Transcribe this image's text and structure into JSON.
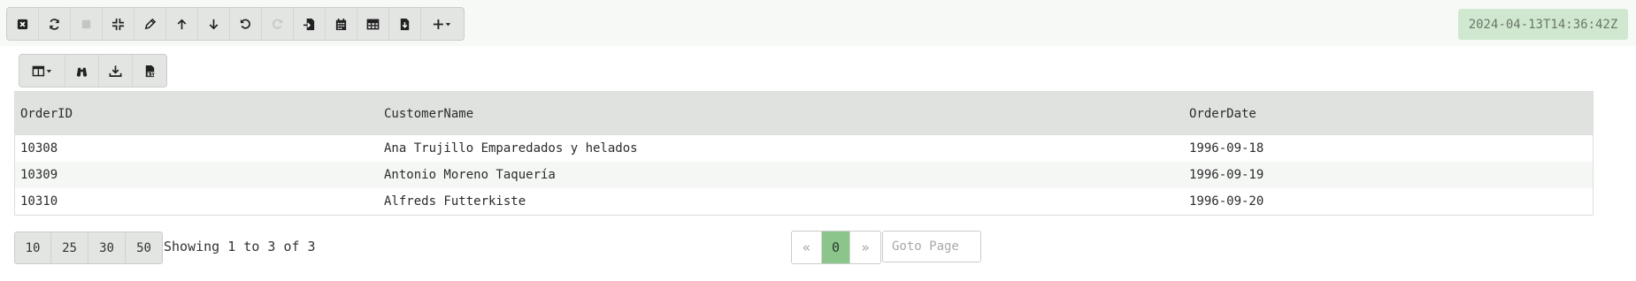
{
  "toolbar": {
    "buttons": [
      {
        "icon": "close-icon",
        "disabled": false
      },
      {
        "icon": "refresh-icon",
        "disabled": false
      },
      {
        "icon": "stop-icon",
        "disabled": true
      },
      {
        "icon": "compress-icon",
        "disabled": false
      },
      {
        "icon": "pencil-icon",
        "disabled": false
      },
      {
        "icon": "arrow-up-icon",
        "disabled": false
      },
      {
        "icon": "arrow-down-icon",
        "disabled": false
      },
      {
        "icon": "undo-icon",
        "disabled": false
      },
      {
        "icon": "redo-icon",
        "disabled": true
      },
      {
        "icon": "import-file-icon",
        "disabled": false
      },
      {
        "icon": "calendar-icon",
        "disabled": false
      },
      {
        "icon": "table-icon",
        "disabled": false
      },
      {
        "icon": "file-download-icon",
        "disabled": false
      },
      {
        "icon": "add-dropdown-icon",
        "disabled": false
      }
    ]
  },
  "status": {
    "timestamp": "2024-04-13T14:36:42Z",
    "timestamp_bg": "#cfe8cf"
  },
  "table_tools": {
    "buttons": [
      "columns-dropdown-icon",
      "binoculars-icon",
      "download-icon",
      "csv-file-icon"
    ]
  },
  "grid": {
    "columns": [
      "OrderID",
      "CustomerName",
      "OrderDate"
    ],
    "rows": [
      [
        "10308",
        "Ana Trujillo Emparedados y helados",
        "1996-09-18"
      ],
      [
        "10309",
        "Antonio Moreno Taquería",
        "1996-09-19"
      ],
      [
        "10310",
        "Alfreds Futterkiste",
        "1996-09-20"
      ]
    ],
    "header_bg": "#dfe2df"
  },
  "pagination": {
    "page_sizes": [
      "10",
      "25",
      "30",
      "50"
    ],
    "showing": "Showing 1 to 3 of 3",
    "prev": "«",
    "current_page": "0",
    "next": "»",
    "goto_placeholder": "Goto Page",
    "active_color": "#8cc58c"
  }
}
